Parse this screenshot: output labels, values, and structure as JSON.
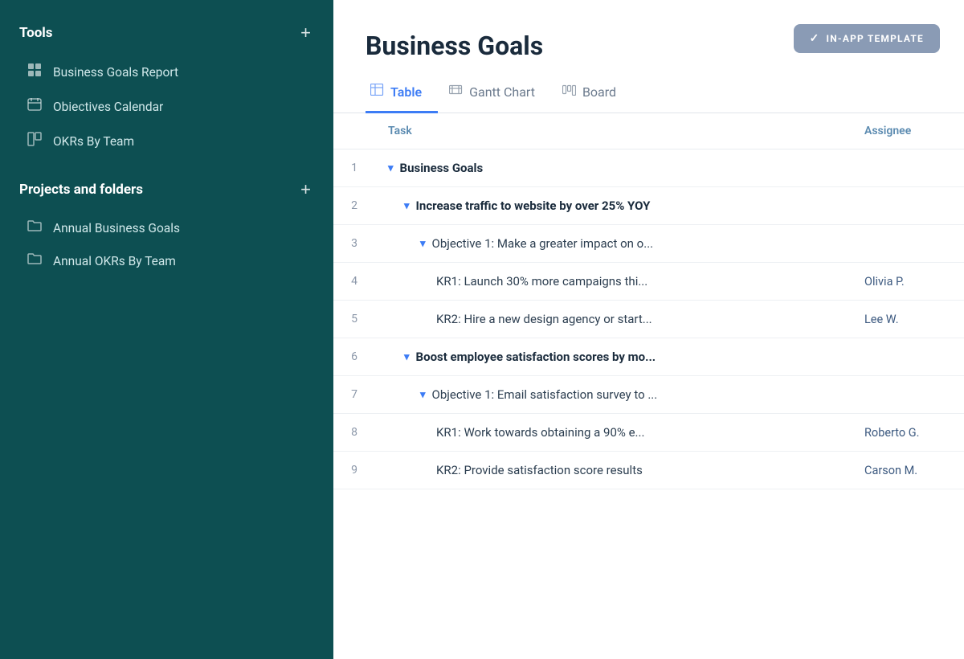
{
  "sidebar": {
    "tools_label": "Tools",
    "add_tool_label": "+",
    "add_project_label": "+",
    "projects_label": "Projects and folders",
    "tool_items": [
      {
        "id": "business-goals-report",
        "icon": "▦",
        "label": "Business Goals Report"
      },
      {
        "id": "objectives-calendar",
        "icon": "▦",
        "label": "Obiectives Calendar"
      },
      {
        "id": "okrs-by-team",
        "icon": "▦",
        "label": "OKRs By Team"
      }
    ],
    "project_items": [
      {
        "id": "annual-business-goals",
        "icon": "🗂",
        "label": "Annual Business Goals"
      },
      {
        "id": "annual-okrs-by-team",
        "icon": "🗂",
        "label": "Annual OKRs By Team"
      }
    ]
  },
  "main": {
    "inapp_badge": "IN-APP TEMPLATE",
    "page_title": "Business Goals",
    "tabs": [
      {
        "id": "table",
        "icon": "⊞",
        "label": "Table",
        "active": true
      },
      {
        "id": "gantt",
        "icon": "≡",
        "label": "Gantt Chart",
        "active": false
      },
      {
        "id": "board",
        "icon": "⊟",
        "label": "Board",
        "active": false
      }
    ],
    "table": {
      "columns": [
        {
          "id": "num",
          "label": ""
        },
        {
          "id": "task",
          "label": "Task"
        },
        {
          "id": "assignee",
          "label": "Assignee"
        }
      ],
      "rows": [
        {
          "num": "1",
          "indent": 0,
          "chevron": true,
          "bold": true,
          "task": "Business Goals",
          "assignee": ""
        },
        {
          "num": "2",
          "indent": 1,
          "chevron": true,
          "bold": true,
          "task": "Increase traffic to website by over 25% YOY",
          "assignee": ""
        },
        {
          "num": "3",
          "indent": 2,
          "chevron": true,
          "bold": false,
          "task": "Objective 1: Make a greater impact on o...",
          "assignee": ""
        },
        {
          "num": "4",
          "indent": 3,
          "chevron": false,
          "bold": false,
          "task": "KR1: Launch 30% more campaigns thi...",
          "assignee": "Olivia P."
        },
        {
          "num": "5",
          "indent": 3,
          "chevron": false,
          "bold": false,
          "task": "KR2: Hire a new design agency or start...",
          "assignee": "Lee W."
        },
        {
          "num": "6",
          "indent": 1,
          "chevron": true,
          "bold": true,
          "task": "Boost employee satisfaction scores by mo...",
          "assignee": ""
        },
        {
          "num": "7",
          "indent": 2,
          "chevron": true,
          "bold": false,
          "task": "Objective 1: Email satisfaction survey to ...",
          "assignee": ""
        },
        {
          "num": "8",
          "indent": 3,
          "chevron": false,
          "bold": false,
          "task": "KR1: Work towards obtaining a 90% e...",
          "assignee": "Roberto G."
        },
        {
          "num": "9",
          "indent": 3,
          "chevron": false,
          "bold": false,
          "task": "KR2: Provide satisfaction score results",
          "assignee": "Carson M."
        }
      ]
    }
  }
}
